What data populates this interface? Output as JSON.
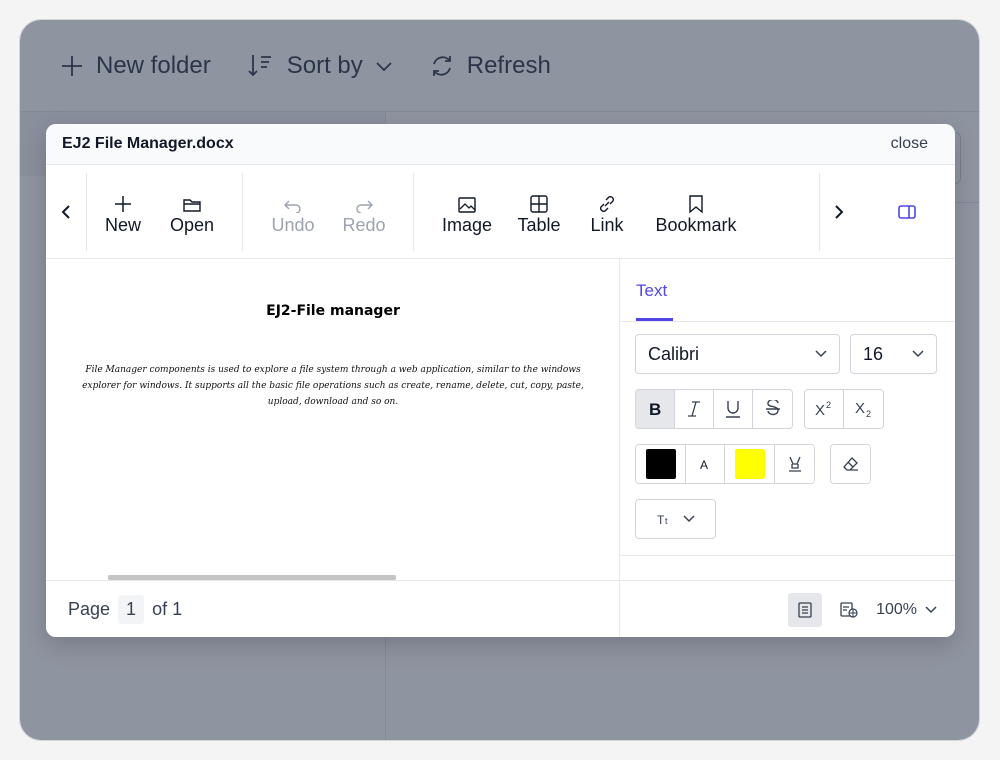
{
  "background_app": {
    "toolbar": {
      "new_folder": "New folder",
      "sort_by": "Sort by",
      "refresh": "Refresh"
    }
  },
  "dialog": {
    "title": "EJ2 File Manager.docx",
    "close_label": "close",
    "ribbon": {
      "new": "New",
      "open": "Open",
      "undo": "Undo",
      "redo": "Redo",
      "image": "Image",
      "table": "Table",
      "link": "Link",
      "bookmark": "Bookmark"
    },
    "document": {
      "heading": "EJ2-File manager",
      "paragraph": "File Manager components is used to explore a file system through a web application, similar to the windows explorer for windows. It supports all the basic file operations such as create, rename, delete, cut, copy, paste, upload, download and so on."
    },
    "side_panel": {
      "tab": "Text",
      "font_family": "Calibri",
      "font_size": "16",
      "font_color": "#000000",
      "highlight_color": "#ffff00",
      "accent": "#4f46e5"
    },
    "status": {
      "page_label": "Page",
      "page_number": "1",
      "of_label": "of 1",
      "zoom": "100%"
    }
  }
}
